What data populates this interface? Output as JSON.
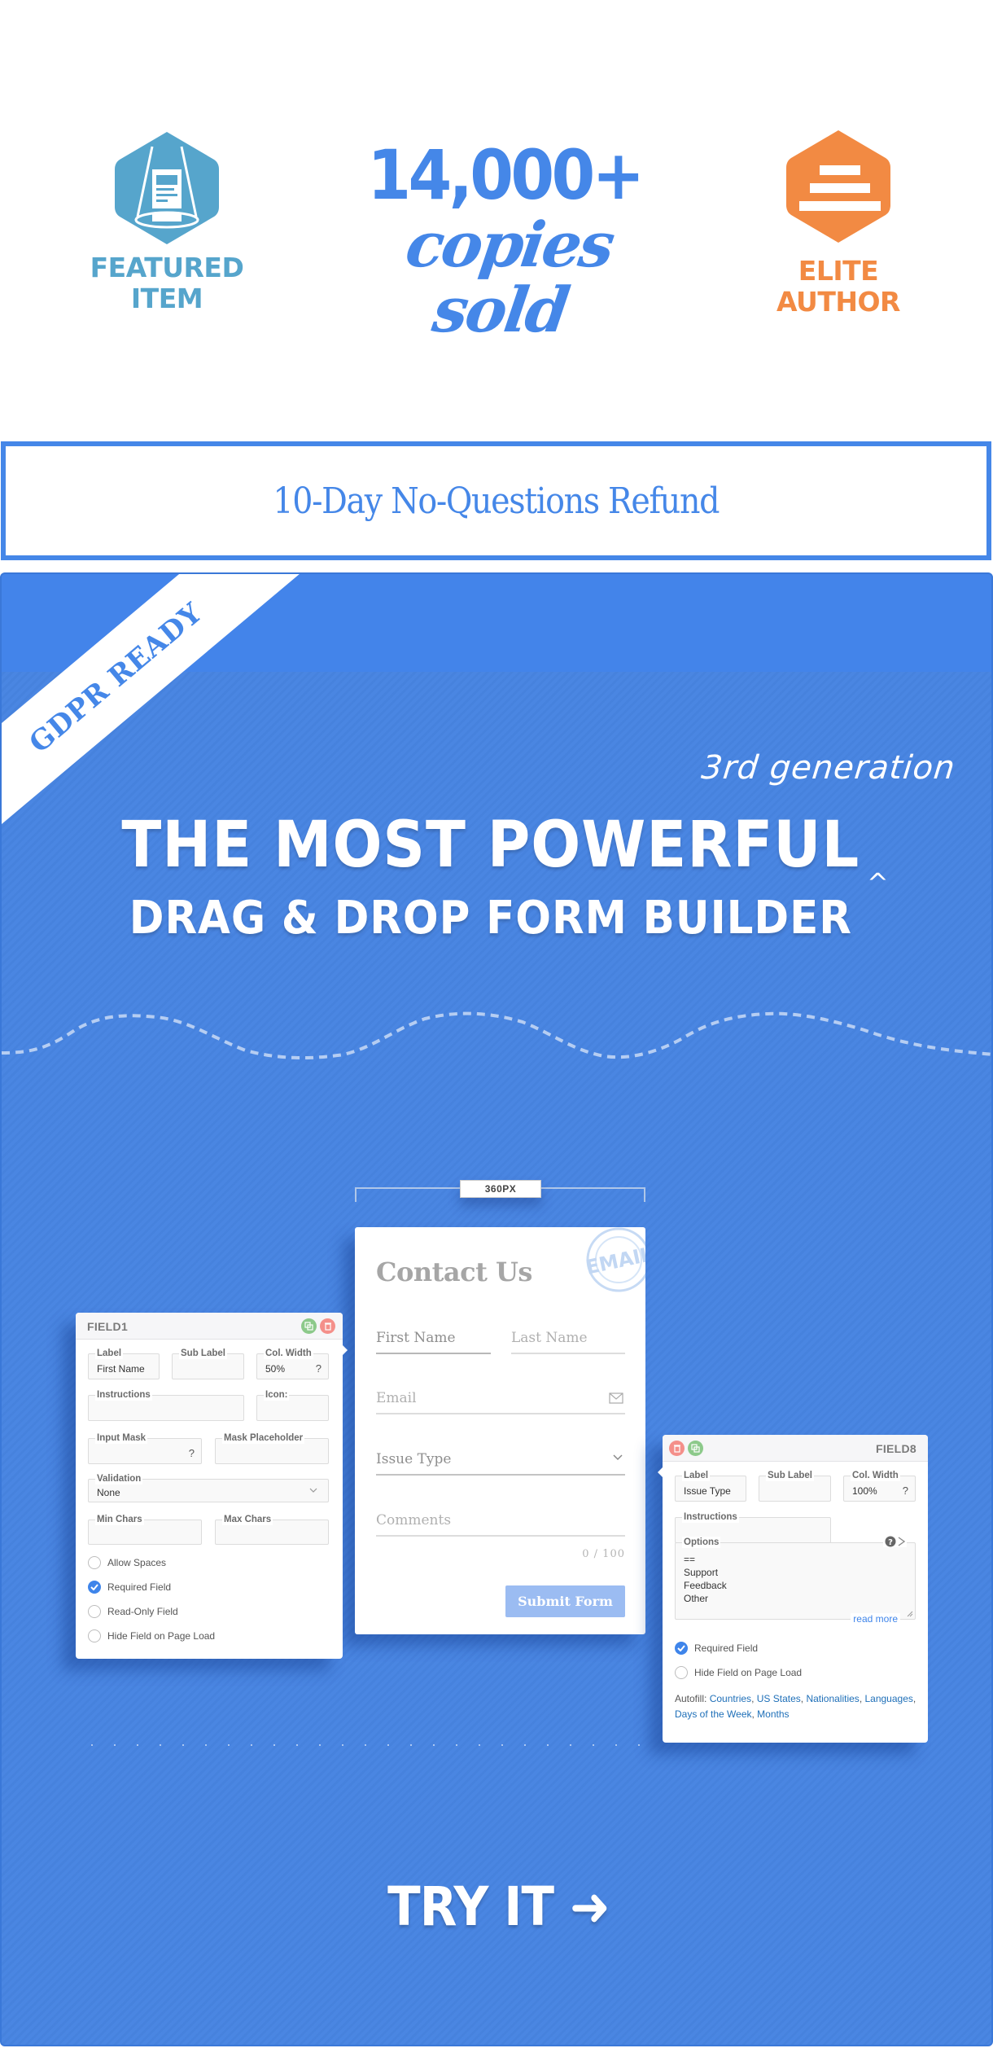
{
  "badges": {
    "featured": {
      "icon": "featured-item-icon",
      "line1": "FEATURED",
      "line2": "ITEM",
      "color": "#56a5cc"
    },
    "elite": {
      "icon": "elite-author-icon",
      "line1": "ELITE",
      "line2": "AUTHOR",
      "color": "#f28a43"
    }
  },
  "sales": {
    "count": "14,000+",
    "caption": "copies sold",
    "color": "#4587e8"
  },
  "refund": {
    "text": "10-Day No-Questions Refund"
  },
  "hero": {
    "ribbon": "GDPR READY",
    "generation": "3rd generation",
    "caret": "^",
    "headline_1": "THE MOST POWERFUL",
    "headline_2": "DRAG & DROP FORM BUILDER",
    "dimension_label": "360PX",
    "background": "#4384ea",
    "cta": "TRY IT ➜"
  },
  "contact_form": {
    "title": "Contact Us",
    "stamp_icon": "email-stamp-icon",
    "first_name": "First Name",
    "last_name": "Last Name",
    "email": "Email",
    "issue_type": "Issue Type",
    "comments": "Comments",
    "counter": "0 / 100",
    "submit": "Submit Form"
  },
  "field1": {
    "title": "FIELD1",
    "label_legend": "Label",
    "label_value": "First Name",
    "sublabel_legend": "Sub Label",
    "sublabel_value": "",
    "colwidth_legend": "Col. Width",
    "colwidth_value": "50%",
    "help": "?",
    "instructions_legend": "Instructions",
    "icon_legend": "Icon:",
    "mask_legend": "Input Mask",
    "mask_placeholder_legend": "Mask Placeholder",
    "validation_legend": "Validation",
    "validation_value": "None",
    "min_legend": "Min Chars",
    "max_legend": "Max Chars",
    "checks": [
      {
        "label": "Allow Spaces",
        "checked": false
      },
      {
        "label": "Required Field",
        "checked": true
      },
      {
        "label": "Read-Only Field",
        "checked": false
      },
      {
        "label": "Hide Field on Page Load",
        "checked": false
      }
    ]
  },
  "field8": {
    "title": "FIELD8",
    "label_legend": "Label",
    "label_value": "Issue Type",
    "sublabel_legend": "Sub Label",
    "colwidth_legend": "Col. Width",
    "colwidth_value": "100%",
    "help": "?",
    "instructions_legend": "Instructions",
    "options_legend": "Options",
    "options": [
      "==",
      "Support",
      "Feedback",
      "Other"
    ],
    "read_more": "read more",
    "checks": [
      {
        "label": "Required Field",
        "checked": true
      },
      {
        "label": "Hide Field on Page Load",
        "checked": false
      }
    ],
    "autofill_label": "Autofill:",
    "autofill_links": [
      "Countries",
      "US States",
      "Nationalities",
      "Languages",
      "Days of the Week",
      "Months"
    ]
  }
}
